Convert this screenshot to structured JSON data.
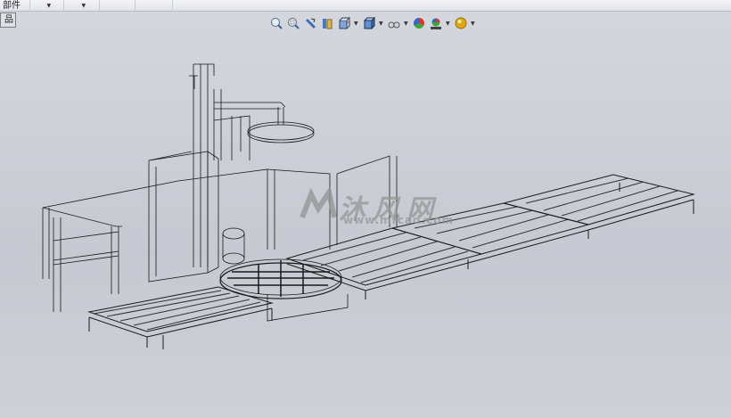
{
  "toolbar": {
    "cells": [
      {
        "label": "部件"
      },
      {
        "label": "",
        "dropdown": true
      },
      {
        "label": "",
        "dropdown": true
      },
      {
        "label": ""
      },
      {
        "label": ""
      }
    ]
  },
  "tab": {
    "label": "品"
  },
  "heads_up": [
    {
      "icon": "zoom-to-fit-icon",
      "dropdown": false
    },
    {
      "icon": "zoom-to-area-icon",
      "dropdown": false
    },
    {
      "icon": "previous-view-icon",
      "dropdown": false
    },
    {
      "icon": "section-view-icon",
      "dropdown": false
    },
    {
      "icon": "view-orientation-icon",
      "dropdown": true
    },
    {
      "icon": "display-style-icon",
      "dropdown": true
    },
    {
      "icon": "hide-show-items-icon",
      "dropdown": true
    },
    {
      "icon": "edit-appearance-icon",
      "dropdown": false
    },
    {
      "icon": "apply-scene-icon",
      "dropdown": true
    },
    {
      "icon": "view-settings-icon",
      "dropdown": true
    }
  ],
  "watermark": {
    "text": "沐风网",
    "url": "www.mfcad.com"
  }
}
